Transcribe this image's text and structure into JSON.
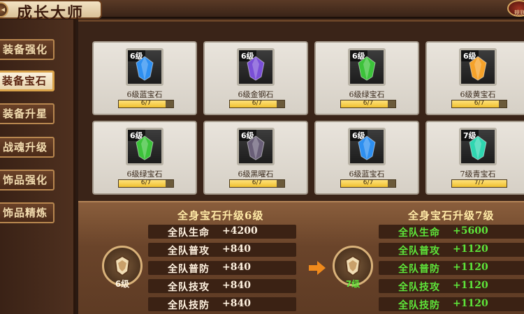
{
  "header": {
    "title": "成长大师",
    "rule_label": "规则"
  },
  "sidebar": {
    "items": [
      {
        "label": "装备强化",
        "active": false
      },
      {
        "label": "装备宝石",
        "active": true
      },
      {
        "label": "装备升星",
        "active": false
      },
      {
        "label": "战魂升级",
        "active": false
      },
      {
        "label": "饰品强化",
        "active": false
      },
      {
        "label": "饰品精炼",
        "active": false
      }
    ]
  },
  "gems": [
    {
      "level": "6级",
      "name": "6级蓝宝石",
      "progress": "6/7",
      "fill": 0.857,
      "color": "#2e8ff0",
      "icon": "blue-gem-icon"
    },
    {
      "level": "6级",
      "name": "6级金钢石",
      "progress": "6/7",
      "fill": 0.857,
      "color": "#7a4fd6",
      "icon": "purple-gem-icon"
    },
    {
      "level": "6级",
      "name": "6级绿宝石",
      "progress": "6/7",
      "fill": 0.857,
      "color": "#3cc23a",
      "icon": "green-gem-icon"
    },
    {
      "level": "6级",
      "name": "6级黄宝石",
      "progress": "6/7",
      "fill": 0.857,
      "color": "#f5a22a",
      "icon": "yellow-gem-icon"
    },
    {
      "level": "6级",
      "name": "6级绿宝石",
      "progress": "6/7",
      "fill": 0.857,
      "color": "#3cc23a",
      "icon": "green-gem-icon"
    },
    {
      "level": "6级",
      "name": "6级黑曜石",
      "progress": "6/7",
      "fill": 0.857,
      "color": "#6a5f78",
      "icon": "black-gem-icon"
    },
    {
      "level": "6级",
      "name": "6级蓝宝石",
      "progress": "6/7",
      "fill": 0.857,
      "color": "#2e8ff0",
      "icon": "blue-gem-icon"
    },
    {
      "level": "7级",
      "name": "7级青宝石",
      "progress": "7/7",
      "fill": 1.0,
      "color": "#2fd6b0",
      "icon": "cyan-gem-icon"
    }
  ],
  "current": {
    "title": "全身宝石升级6级",
    "emblem_label": "6级",
    "stats": [
      {
        "name": "全队生命",
        "value": "+4200"
      },
      {
        "name": "全队普攻",
        "value": "+840"
      },
      {
        "name": "全队普防",
        "value": "+840"
      },
      {
        "name": "全队技攻",
        "value": "+840"
      },
      {
        "name": "全队技防",
        "value": "+840"
      }
    ]
  },
  "next": {
    "title": "全身宝石升级7级",
    "emblem_label": "7级",
    "stats": [
      {
        "name": "全队生命",
        "value": "+5600"
      },
      {
        "name": "全队普攻",
        "value": "+1120"
      },
      {
        "name": "全队普防",
        "value": "+1120"
      },
      {
        "name": "全队技攻",
        "value": "+1120"
      },
      {
        "name": "全队技防",
        "value": "+1120"
      }
    ]
  },
  "colors": {
    "accent_gold": "#ffe9a6",
    "stat_up_green": "#5ee53a",
    "panel_brown": "#6a442a"
  }
}
